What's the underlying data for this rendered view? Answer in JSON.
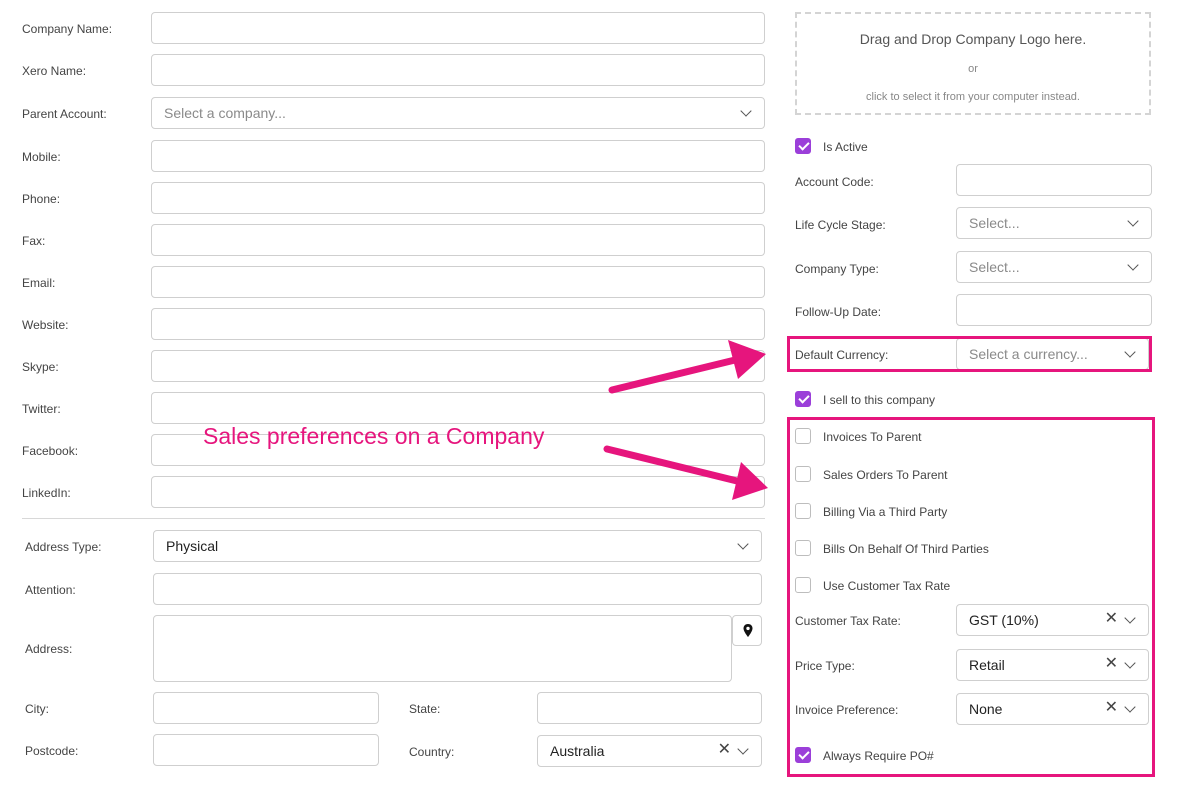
{
  "contact_fields": [
    {
      "key": "company_name",
      "label": "Company Name:"
    },
    {
      "key": "xero_name",
      "label": "Xero Name:"
    },
    {
      "key": "parent_account",
      "label": "Parent Account:",
      "placeholder": "Select a company..."
    },
    {
      "key": "mobile",
      "label": "Mobile:"
    },
    {
      "key": "phone",
      "label": "Phone:"
    },
    {
      "key": "fax",
      "label": "Fax:"
    },
    {
      "key": "email",
      "label": "Email:"
    },
    {
      "key": "website",
      "label": "Website:"
    },
    {
      "key": "skype",
      "label": "Skype:"
    },
    {
      "key": "twitter",
      "label": "Twitter:"
    },
    {
      "key": "facebook",
      "label": "Facebook:"
    },
    {
      "key": "linkedin",
      "label": "LinkedIn:"
    }
  ],
  "address": {
    "type_label": "Address Type:",
    "type_value": "Physical",
    "attention_label": "Attention:",
    "address_label": "Address:",
    "city_label": "City:",
    "state_label": "State:",
    "postcode_label": "Postcode:",
    "country_label": "Country:",
    "country_value": "Australia"
  },
  "logo_upload": {
    "title": "Drag and Drop Company Logo here.",
    "or": "or",
    "hint": "click to select it from your computer instead."
  },
  "company_settings": {
    "is_active_label": "Is Active",
    "is_active": true,
    "account_code_label": "Account Code:",
    "lifecycle_label": "Life Cycle Stage:",
    "lifecycle_placeholder": "Select...",
    "company_type_label": "Company Type:",
    "company_type_placeholder": "Select...",
    "followup_label": "Follow-Up Date:",
    "currency_label": "Default Currency:",
    "currency_placeholder": "Select a currency..."
  },
  "sales": {
    "sell_label": "I sell to this company",
    "sell_checked": true,
    "options": [
      {
        "label": "Invoices To Parent",
        "checked": false
      },
      {
        "label": "Sales Orders To Parent",
        "checked": false
      },
      {
        "label": "Billing Via a Third Party",
        "checked": false
      },
      {
        "label": "Bills On Behalf Of Third Parties",
        "checked": false
      },
      {
        "label": "Use Customer Tax Rate",
        "checked": false
      }
    ],
    "tax_rate_label": "Customer Tax Rate:",
    "tax_rate_value": "GST (10%)",
    "price_type_label": "Price Type:",
    "price_type_value": "Retail",
    "invoice_pref_label": "Invoice Preference:",
    "invoice_pref_value": "None",
    "require_po_label": "Always Require PO#",
    "require_po_checked": true
  },
  "annotation": {
    "text": "Sales preferences on a Company",
    "color": "#e6157d"
  },
  "colors": {
    "accent": "#9b3fd9",
    "highlight": "#e6157d"
  }
}
